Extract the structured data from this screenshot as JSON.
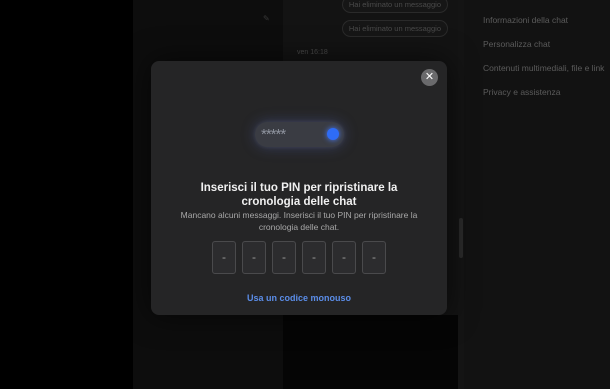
{
  "background": {
    "messages": [
      {
        "text": "Hai eliminato un messaggio"
      },
      {
        "text": "Hai eliminato un messaggio"
      }
    ],
    "timestamp": "ven 16:18",
    "right_panel": {
      "items": [
        {
          "label": "Informazioni della chat"
        },
        {
          "label": "Personalizza chat"
        },
        {
          "label": "Contenuti multimediali, file e link"
        },
        {
          "label": "Privacy e assistenza"
        }
      ]
    }
  },
  "modal": {
    "close_icon": "close-icon",
    "illustration": {
      "masked": "*****",
      "icon": "pin-illustration-icon",
      "accent": "#2e6cf6"
    },
    "title": "Inserisci il tuo PIN per ripristinare la cronologia delle chat",
    "description": "Mancano alcuni messaggi. Inserisci il tuo PIN per ripristinare la cronologia delle chat.",
    "pin_digits": [
      "-",
      "-",
      "-",
      "-",
      "-",
      "-"
    ],
    "otp_link": "Usa un codice monouso",
    "link_color": "#5b8de8"
  }
}
